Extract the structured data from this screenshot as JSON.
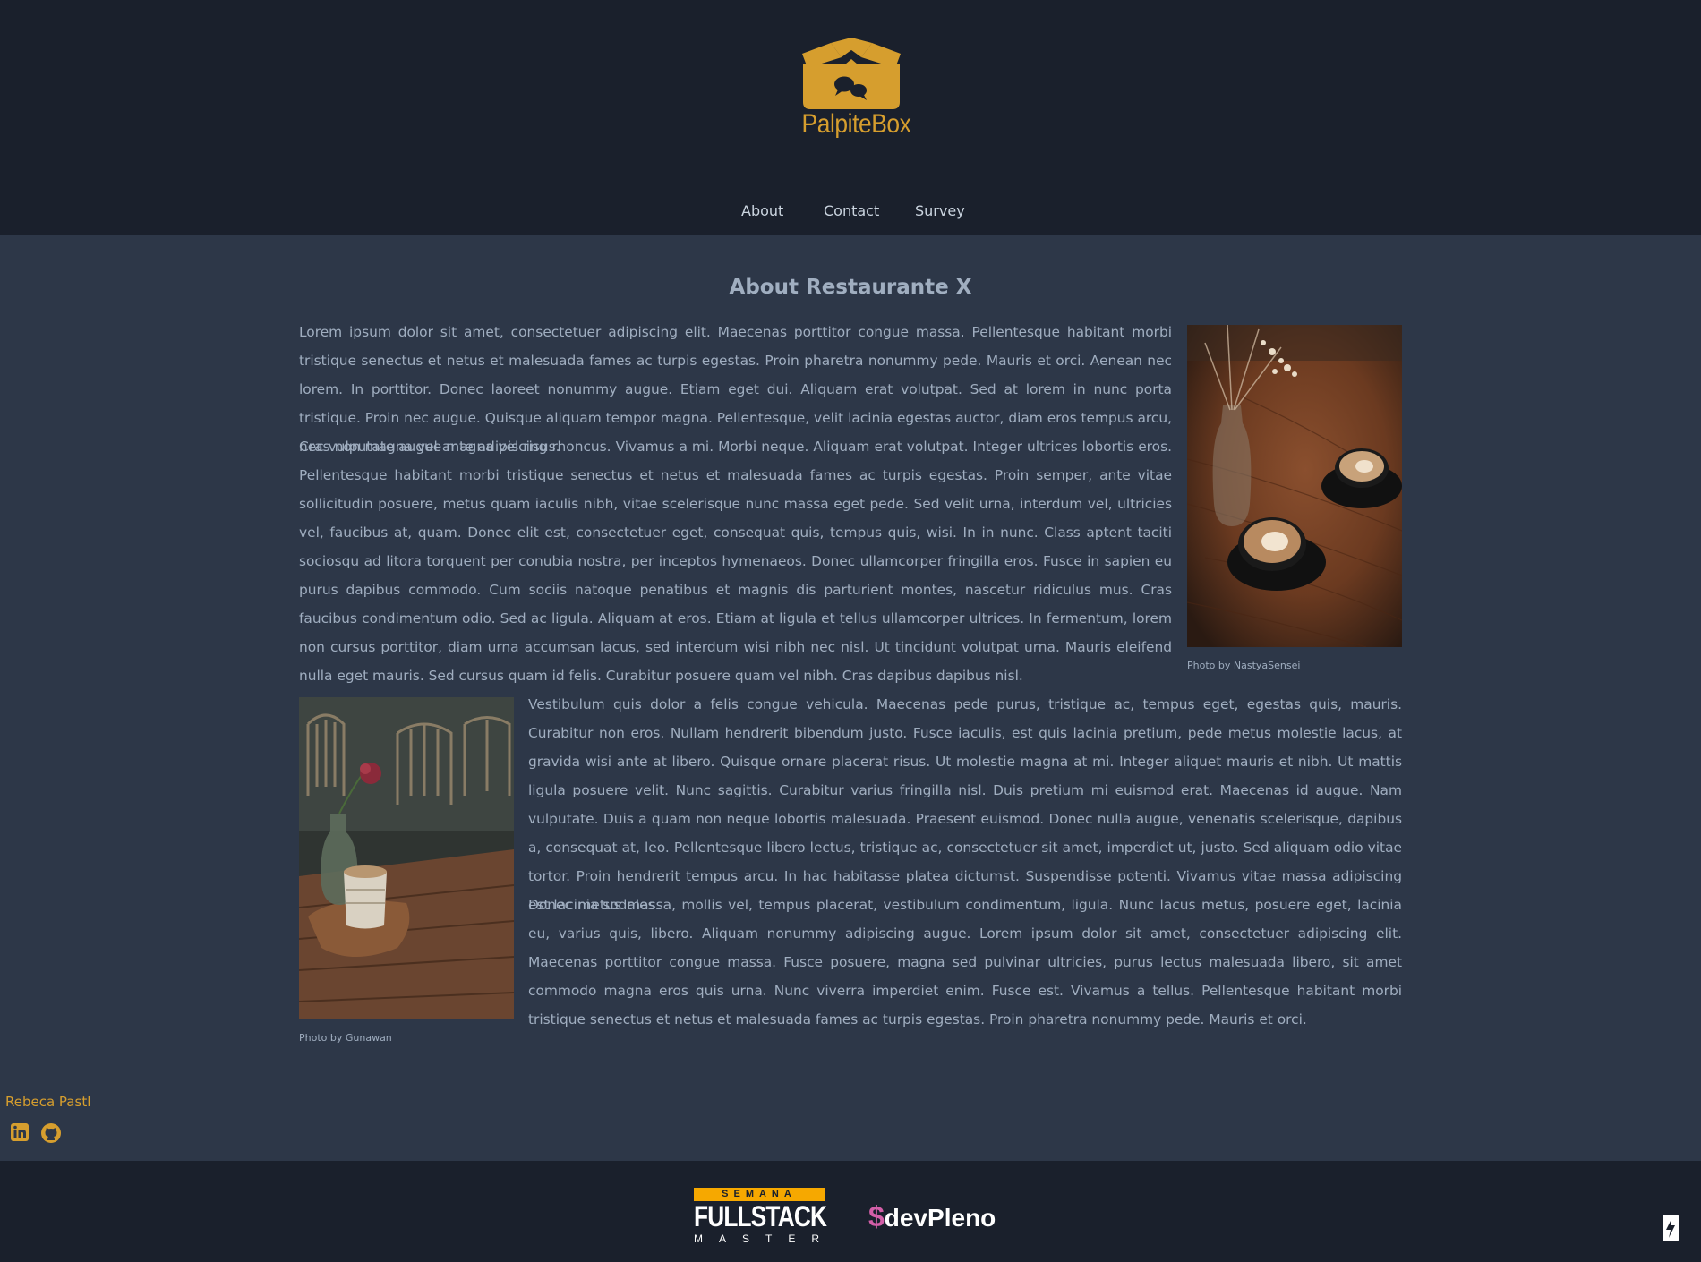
{
  "header": {
    "logo_text": "PalpiteBox",
    "nav": [
      "About",
      "Contact",
      "Survey"
    ]
  },
  "main": {
    "title": "About Restaurante X",
    "paragraphs": [
      "Lorem ipsum dolor sit amet, consectetuer adipiscing elit. Maecenas porttitor congue massa. Pellentesque habitant morbi tristique senectus et netus et malesuada fames ac turpis egestas. Proin pharetra nonummy pede. Mauris et orci. Aenean nec lorem. In porttitor. Donec laoreet nonummy augue. Etiam eget dui. Aliquam erat volutpat. Sed at lorem in nunc porta tristique. Proin nec augue. Quisque aliquam tempor magna. Pellentesque, velit lacinia egestas auctor, diam eros tempus arcu, nec vulputate augue magna vel risus.",
      "Cras non magna vel ante adipiscing rhoncus. Vivamus a mi. Morbi neque. Aliquam erat volutpat. Integer ultrices lobortis eros. Pellentesque habitant morbi tristique senectus et netus et malesuada fames ac turpis egestas. Proin semper, ante vitae sollicitudin posuere, metus quam iaculis nibh, vitae scelerisque nunc massa eget pede. Sed velit urna, interdum vel, ultricies vel, faucibus at, quam. Donec elit est, consectetuer eget, consequat quis, tempus quis, wisi. In in nunc. Class aptent taciti sociosqu ad litora torquent per conubia nostra, per inceptos hymenaeos. Donec ullamcorper fringilla eros. Fusce in sapien eu purus dapibus commodo. Cum sociis natoque penatibus et magnis dis parturient montes, nascetur ridiculus mus. Cras faucibus condimentum odio. Sed ac ligula. Aliquam at eros. Etiam at ligula et tellus ullamcorper ultrices. In fermentum, lorem non cursus porttitor, diam urna accumsan lacus, sed interdum wisi nibh nec nisl. Ut tincidunt volutpat urna. Mauris eleifend nulla eget mauris. Sed cursus quam id felis. Curabitur posuere quam vel nibh. Cras dapibus dapibus nisl.",
      "Vestibulum quis dolor a felis congue vehicula. Maecenas pede purus, tristique ac, tempus eget, egestas quis, mauris. Curabitur non eros. Nullam hendrerit bibendum justo. Fusce iaculis, est quis lacinia pretium, pede metus molestie lacus, at gravida wisi ante at libero. Quisque ornare placerat risus. Ut molestie magna at mi. Integer aliquet mauris et nibh. Ut mattis ligula posuere velit. Nunc sagittis. Curabitur varius fringilla nisl. Duis pretium mi euismod erat. Maecenas id augue. Nam vulputate. Duis a quam non neque lobortis malesuada. Praesent euismod. Donec nulla augue, venenatis scelerisque, dapibus a, consequat at, leo. Pellentesque libero lectus, tristique ac, consectetuer sit amet, imperdiet ut, justo. Sed aliquam odio vitae tortor. Proin hendrerit tempus arcu. In hac habitasse platea dictumst. Suspendisse potenti. Vivamus vitae massa adipiscing est lacinia sodales.",
      "Donec metus massa, mollis vel, tempus placerat, vestibulum condimentum, ligula. Nunc lacus metus, posuere eget, lacinia eu, varius quis, libero. Aliquam nonummy adipiscing augue. Lorem ipsum dolor sit amet, consectetuer adipiscing elit. Maecenas porttitor congue massa. Fusce posuere, magna sed pulvinar ultricies, purus lectus malesuada libero, sit amet commodo magna eros quis urna. Nunc viverra imperdiet enim. Fusce est. Vivamus a tellus. Pellentesque habitant morbi tristique senectus et netus et malesuada fames ac turpis egestas. Proin pharetra nonummy pede. Mauris et orci."
    ],
    "photo1_caption": "Photo by NastyaSensei",
    "photo2_caption": "Photo by Gunawan"
  },
  "author": {
    "name": "Rebeca Pastl",
    "icons": [
      "linkedin-icon",
      "github-icon"
    ]
  },
  "footer": {
    "fullstack": {
      "top": "SEMANA",
      "middle": "FULLSTACK",
      "bottom": "MASTER"
    },
    "devpleno": {
      "symbol": "$",
      "name": "devPleno"
    }
  },
  "colors": {
    "header_bg": "#1a202c",
    "page_bg": "#2d3748",
    "accent": "#d69e2e",
    "text": "#a0aec0"
  }
}
